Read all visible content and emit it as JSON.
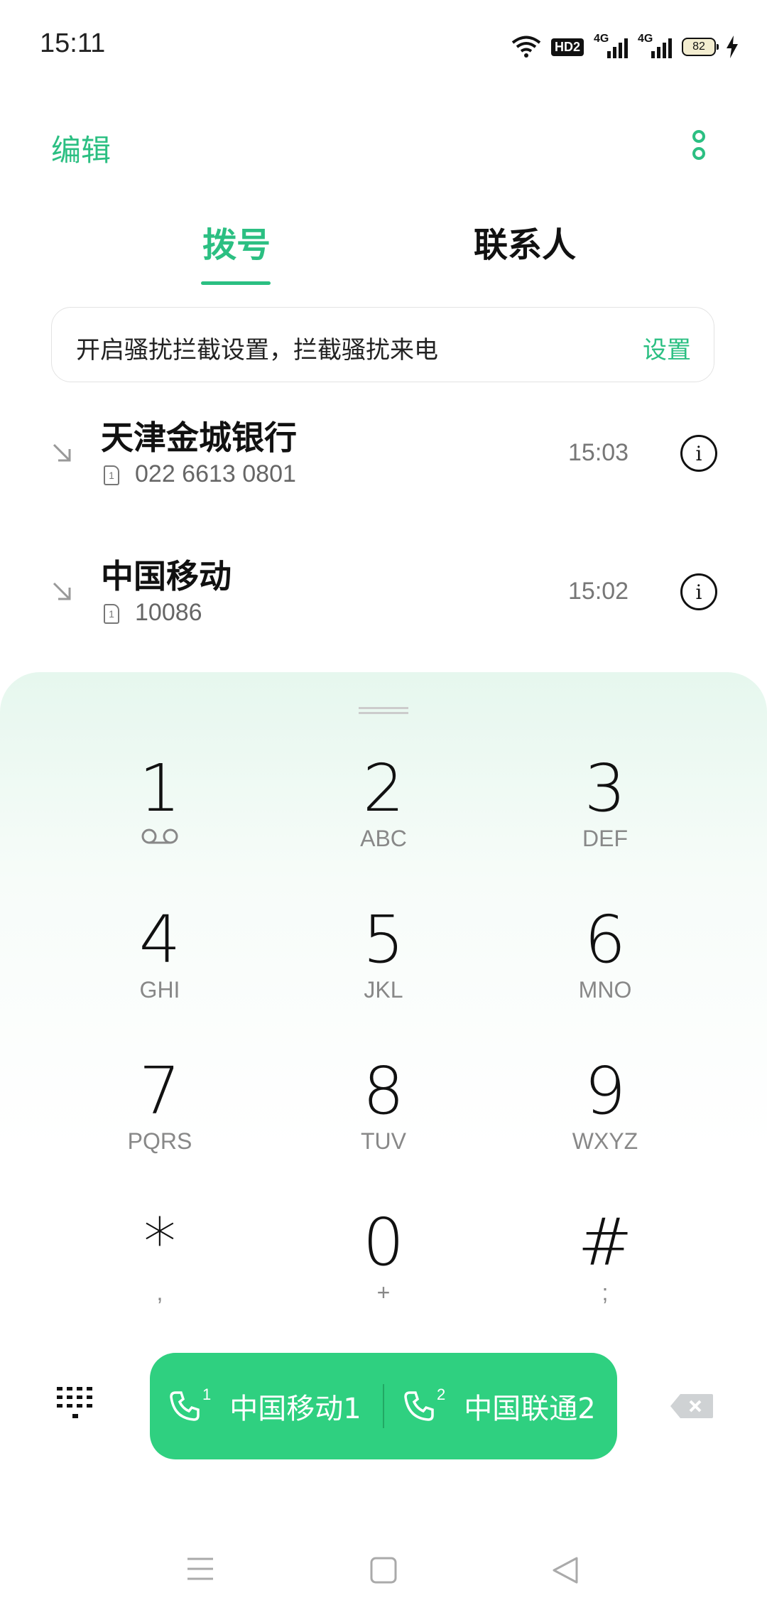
{
  "status_bar": {
    "time": "15:11",
    "hd_label": "HD2",
    "sim1_network": "4G",
    "sim2_network": "4G",
    "battery": "82"
  },
  "header": {
    "edit_label": "编辑"
  },
  "tabs": {
    "dial": "拨号",
    "contacts": "联系人"
  },
  "banner": {
    "text": "开启骚扰拦截设置，拦截骚扰来电",
    "button": "设置"
  },
  "call_log": [
    {
      "name": "天津金城银行",
      "sim": "1",
      "number": "022 6613 0801",
      "time": "15:03"
    },
    {
      "name": "中国移动",
      "sim": "1",
      "number": "10086",
      "time": "15:02"
    }
  ],
  "dialpad": {
    "keys": [
      {
        "digit": "1",
        "letters": ""
      },
      {
        "digit": "2",
        "letters": "ABC"
      },
      {
        "digit": "3",
        "letters": "DEF"
      },
      {
        "digit": "4",
        "letters": "GHI"
      },
      {
        "digit": "5",
        "letters": "JKL"
      },
      {
        "digit": "6",
        "letters": "MNO"
      },
      {
        "digit": "7",
        "letters": "PQRS"
      },
      {
        "digit": "8",
        "letters": "TUV"
      },
      {
        "digit": "9",
        "letters": "WXYZ"
      },
      {
        "digit": "*",
        "letters": ","
      },
      {
        "digit": "0",
        "letters": "+"
      },
      {
        "digit": "#",
        "letters": ";"
      }
    ]
  },
  "call_buttons": {
    "sim1": {
      "num": "1",
      "label": "中国移动1"
    },
    "sim2": {
      "num": "2",
      "label": "中国联通2"
    }
  },
  "colors": {
    "accent": "#2bbf82",
    "call_button": "#2fd080"
  }
}
